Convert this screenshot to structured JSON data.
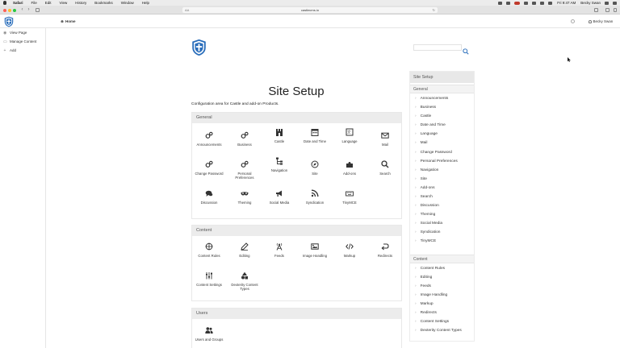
{
  "menubar": {
    "app": "Safari",
    "items": [
      "File",
      "Edit",
      "View",
      "History",
      "Bookmarks",
      "Window",
      "Help"
    ],
    "clock": "Fri 9:47 AM",
    "user": "Becky Swan"
  },
  "browser": {
    "url": "castlecms.io",
    "reader": "AA"
  },
  "header": {
    "breadcrumb": "Home",
    "user": "Becky Swan"
  },
  "sidebar": {
    "items": [
      {
        "label": "View Page",
        "icon": "eye-icon"
      },
      {
        "label": "Manage Content",
        "icon": "folder-icon"
      },
      {
        "label": "Add",
        "icon": "plus-icon"
      }
    ]
  },
  "main": {
    "title": "Site Setup",
    "description": "Configuration area for Castle and add-on Products.",
    "sections": [
      {
        "title": "General",
        "items": [
          {
            "label": "Announcements",
            "icon": "gears-icon"
          },
          {
            "label": "Business",
            "icon": "gears-icon"
          },
          {
            "label": "Castle",
            "icon": "castle-icon"
          },
          {
            "label": "Date and Time",
            "icon": "calendar-icon"
          },
          {
            "label": "Language",
            "icon": "language-icon"
          },
          {
            "label": "Mail",
            "icon": "mail-icon"
          },
          {
            "label": "Change Password",
            "icon": "gears-icon"
          },
          {
            "label": "Personal Preferences",
            "icon": "gears-icon"
          },
          {
            "label": "Navigation",
            "icon": "sitemap-icon"
          },
          {
            "label": "Site",
            "icon": "compass-icon"
          },
          {
            "label": "Add-ons",
            "icon": "puzzle-icon"
          },
          {
            "label": "Search",
            "icon": "search-icon"
          },
          {
            "label": "Discussion",
            "icon": "comments-icon"
          },
          {
            "label": "Theming",
            "icon": "mask-icon"
          },
          {
            "label": "Social Media",
            "icon": "megaphone-icon"
          },
          {
            "label": "Syndication",
            "icon": "rss-icon"
          },
          {
            "label": "TinyMCE",
            "icon": "keyboard-icon"
          }
        ]
      },
      {
        "title": "Content",
        "items": [
          {
            "label": "Content Rules",
            "icon": "crosshair-icon"
          },
          {
            "label": "Editing",
            "icon": "pencil-icon"
          },
          {
            "label": "Feeds",
            "icon": "antenna-icon"
          },
          {
            "label": "Image Handling",
            "icon": "image-icon"
          },
          {
            "label": "Markup",
            "icon": "code-icon"
          },
          {
            "label": "Redirects",
            "icon": "redirect-icon"
          },
          {
            "label": "Content Settings",
            "icon": "sliders-icon"
          },
          {
            "label": "Dexterity Content Types",
            "icon": "shapes-icon"
          }
        ]
      },
      {
        "title": "Users",
        "items": [
          {
            "label": "Users and Groups",
            "icon": "users-icon"
          }
        ]
      }
    ]
  },
  "portlet": {
    "title": "Site Setup",
    "groups": [
      {
        "title": "General",
        "items": [
          "Announcements",
          "Business",
          "Castle",
          "Date and Time",
          "Language",
          "Mail",
          "Change Password",
          "Personal Preferences",
          "Navigation",
          "Site",
          "Add-ons",
          "Search",
          "Discussion",
          "Theming",
          "Social Media",
          "Syndication",
          "TinyMCE"
        ]
      },
      {
        "title": "Content",
        "items": [
          "Content Rules",
          "Editing",
          "Feeds",
          "Image Handling",
          "Markup",
          "Redirects",
          "Content Settings",
          "Dexterity Content Types"
        ]
      }
    ]
  },
  "colors": {
    "accent": "#2a6ebb",
    "panel_header": "#ececec",
    "text": "#222222"
  }
}
